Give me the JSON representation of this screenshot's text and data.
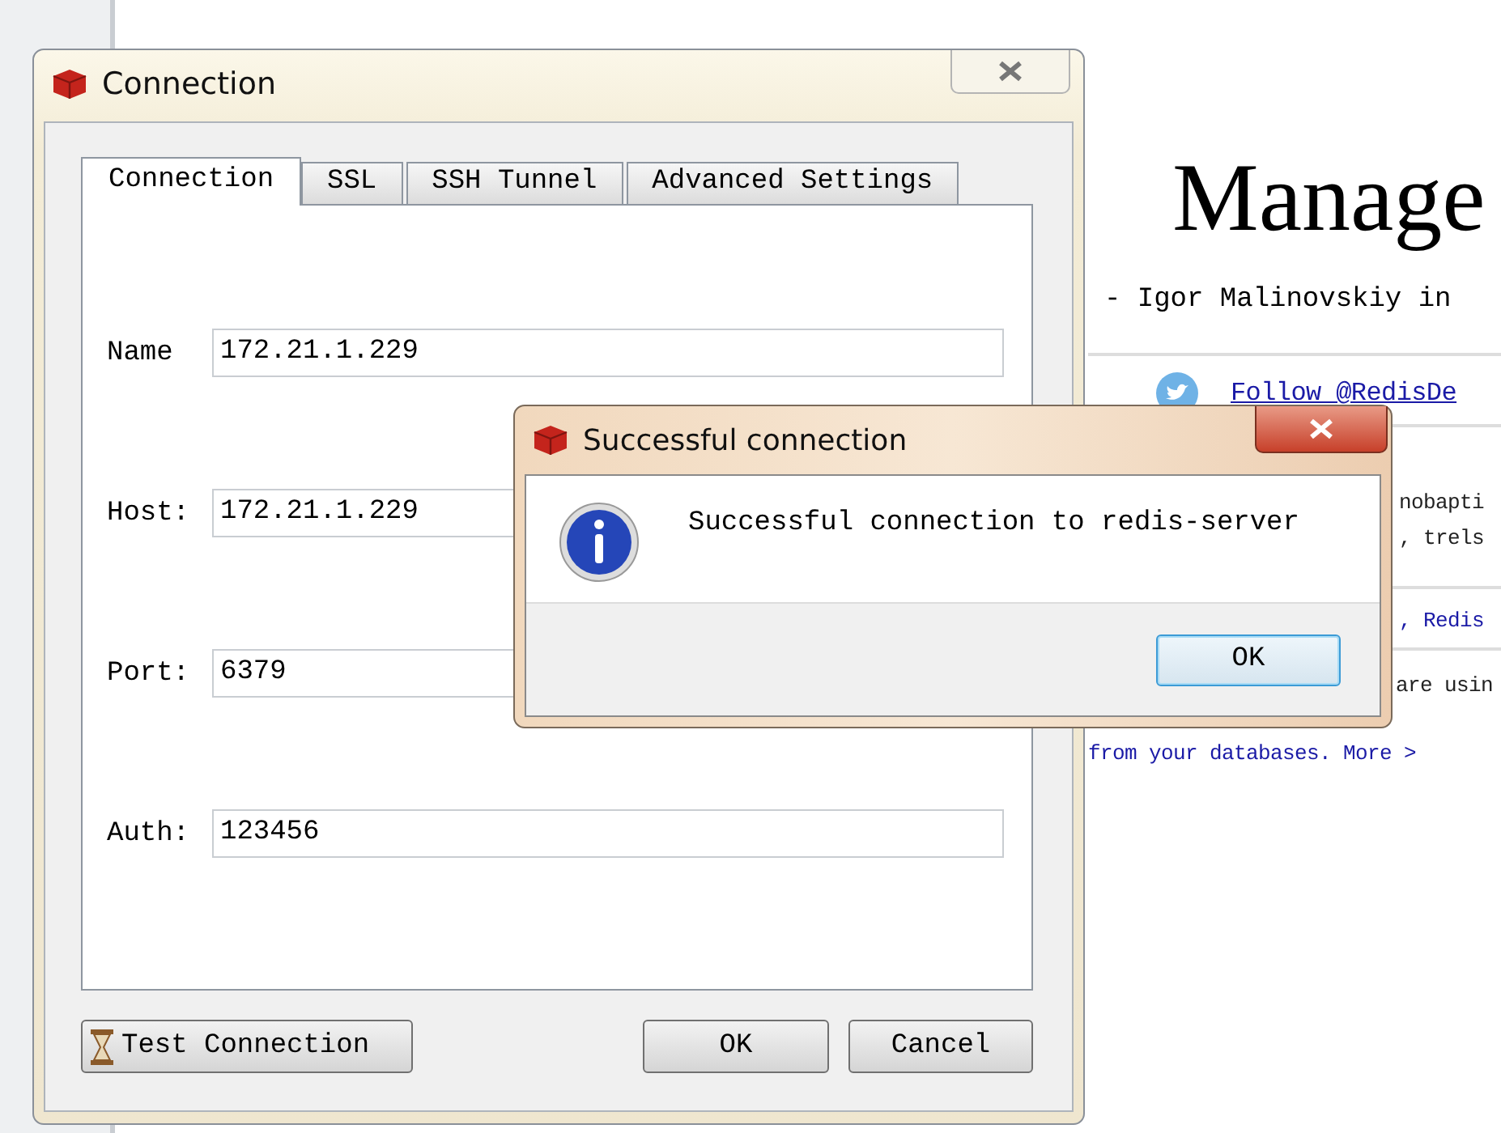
{
  "background_page": {
    "heading": "Manage",
    "byline": "- Igor Malinovskiy in",
    "follow_link": "Follow @RedisDe",
    "lines": [
      {
        "text": "nobapti",
        "kind": "plain"
      },
      {
        "text": ", trels",
        "kind": "plain"
      },
      {
        "text": ", Redis",
        "kind": "link"
      },
      {
        "text": "are usin",
        "kind": "plain"
      },
      {
        "text": "from your databases. More >",
        "kind": "link"
      }
    ]
  },
  "connection_window": {
    "title": "Connection",
    "tabs": [
      {
        "label": "Connection",
        "selected": true
      },
      {
        "label": "SSL",
        "selected": false
      },
      {
        "label": "SSH Tunnel",
        "selected": false
      },
      {
        "label": "Advanced Settings",
        "selected": false
      }
    ],
    "fields": [
      {
        "label": "Name",
        "value": "172.21.1.229"
      },
      {
        "label": "Host:",
        "value": "172.21.1.229"
      },
      {
        "label": "Port:",
        "value": "6379"
      },
      {
        "label": "Auth:",
        "value": "123456"
      }
    ],
    "buttons": {
      "test": "Test Connection",
      "ok": "OK",
      "cancel": "Cancel"
    }
  },
  "message_box": {
    "title": "Successful connection",
    "message": "Successful connection to redis-server",
    "button": "OK"
  }
}
